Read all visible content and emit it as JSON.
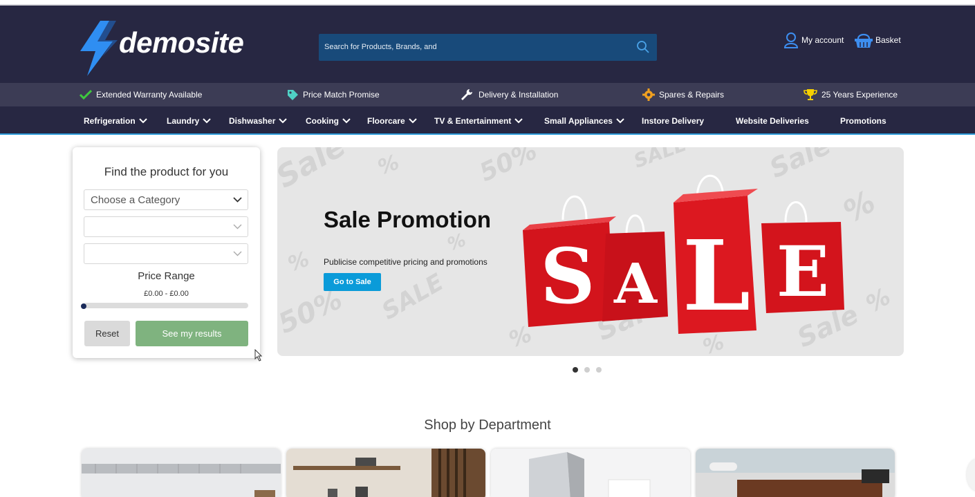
{
  "brand": {
    "logo_text": "demosite"
  },
  "search": {
    "placeholder": "Search for Products, Brands, and"
  },
  "account": {
    "my_account": "My account",
    "basket": "Basket"
  },
  "usps": [
    {
      "label": "Extended Warranty Available",
      "icon": "checkmark-icon"
    },
    {
      "label": "Price Match Promise",
      "icon": "price-tag-icon"
    },
    {
      "label": "Delivery & Installation",
      "icon": "wrench-icon"
    },
    {
      "label": "Spares & Repairs",
      "icon": "gear-icon"
    },
    {
      "label": "25 Years Experience",
      "icon": "trophy-icon"
    }
  ],
  "nav": [
    {
      "label": "Refrigeration",
      "dropdown": true
    },
    {
      "label": "Laundry",
      "dropdown": true
    },
    {
      "label": "Dishwasher",
      "dropdown": true
    },
    {
      "label": "Cooking",
      "dropdown": true
    },
    {
      "label": "Floorcare",
      "dropdown": true
    },
    {
      "label": "TV & Entertainment",
      "dropdown": true
    },
    {
      "label": "Small Appliances",
      "dropdown": true
    },
    {
      "label": "Instore Delivery",
      "dropdown": false
    },
    {
      "label": "Website Deliveries",
      "dropdown": false
    },
    {
      "label": "Promotions",
      "dropdown": false
    }
  ],
  "finder": {
    "title": "Find the product for you",
    "category_select": "Choose a Category",
    "select_2": "",
    "select_3": "",
    "price_label": "Price Range",
    "price_value": "£0.00 - £0.00",
    "slider_position": 0,
    "reset_label": "Reset",
    "results_label": "See my results"
  },
  "banner": {
    "title": "Sale Promotion",
    "subtitle": "Publicise competitive pricing and promotions",
    "button_label": "Go to Sale",
    "bag_letters": [
      "S",
      "A",
      "L",
      "E"
    ],
    "active_slide": 1,
    "slide_count": 3
  },
  "department": {
    "title": "Shop by Department"
  },
  "colors": {
    "header_bg": "#272742",
    "usp_bg": "#3c3c55",
    "search_bg": "#184a7a",
    "accent_blue": "#0a9bd9",
    "results_green": "#7fb37f",
    "bag_red": "#d3141c"
  }
}
